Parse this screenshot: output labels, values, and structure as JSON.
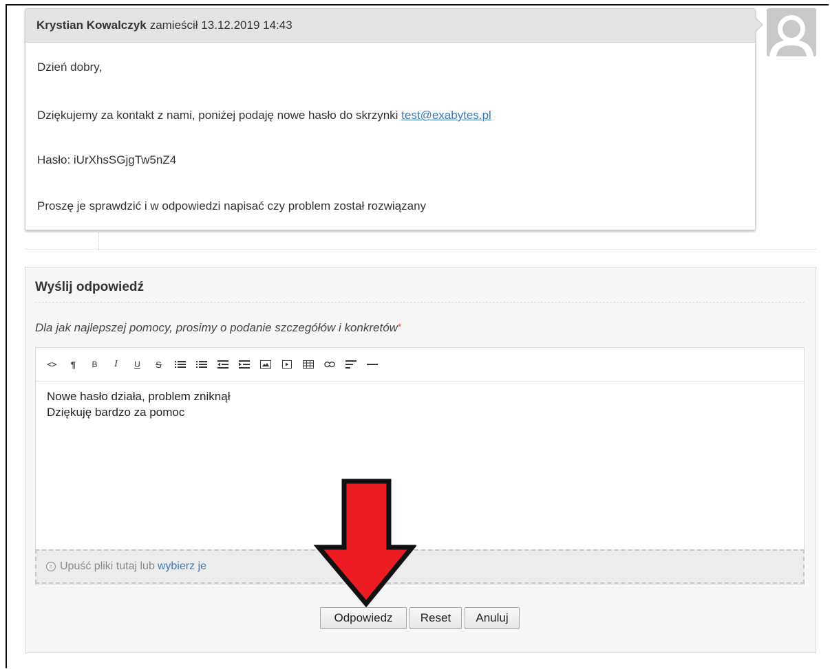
{
  "message": {
    "author": "Krystian Kowalczyk",
    "meta": "zamieścił 13.12.2019 14:43",
    "lines": {
      "greeting": "Dzień dobry,",
      "intro_prefix": "Dziękujemy za kontakt z nami, poniżej podaję nowe hasło do skrzynki",
      "email_link": "test@exabytes.pl",
      "password_line": "Hasło: iUrXhsSGjgTw5nZ4",
      "closing": "Proszę je sprawdzić i w odpowiedzi napisać czy problem został rozwiązany"
    }
  },
  "reply": {
    "title": "Wyślij odpowiedź",
    "hint": "Dla jak najlepszej pomocy, prosimy o podanie szczegółów i konkretów",
    "required_mark": "*",
    "toolbar": [
      {
        "name": "html-icon",
        "glyph": "<>"
      },
      {
        "name": "paragraph-icon",
        "glyph": "¶"
      },
      {
        "name": "bold-icon",
        "glyph": "B"
      },
      {
        "name": "italic-icon",
        "glyph": "I"
      },
      {
        "name": "underline-icon",
        "glyph": "U"
      },
      {
        "name": "strikethrough-icon",
        "glyph": "S"
      },
      {
        "name": "unordered-list-icon",
        "glyph": ""
      },
      {
        "name": "ordered-list-icon",
        "glyph": ""
      },
      {
        "name": "outdent-icon",
        "glyph": ""
      },
      {
        "name": "indent-icon",
        "glyph": ""
      },
      {
        "name": "image-icon",
        "glyph": ""
      },
      {
        "name": "video-icon",
        "glyph": ""
      },
      {
        "name": "table-icon",
        "glyph": ""
      },
      {
        "name": "link-icon",
        "glyph": ""
      },
      {
        "name": "align-icon",
        "glyph": ""
      },
      {
        "name": "horizontal-rule-icon",
        "glyph": ""
      }
    ],
    "content_lines": [
      "Nowe hasło działa, problem zniknął",
      "Dziękuję bardzo za pomoc"
    ],
    "dropzone_text": "Upuść pliki tutaj lub",
    "dropzone_link": "wybierz je",
    "buttons": {
      "reply": "Odpowiedz",
      "reset": "Reset",
      "cancel": "Anuluj"
    }
  },
  "colors": {
    "link": "#3a78b8",
    "annotation_arrow": "#ed1c24",
    "required": "#d9534f"
  }
}
